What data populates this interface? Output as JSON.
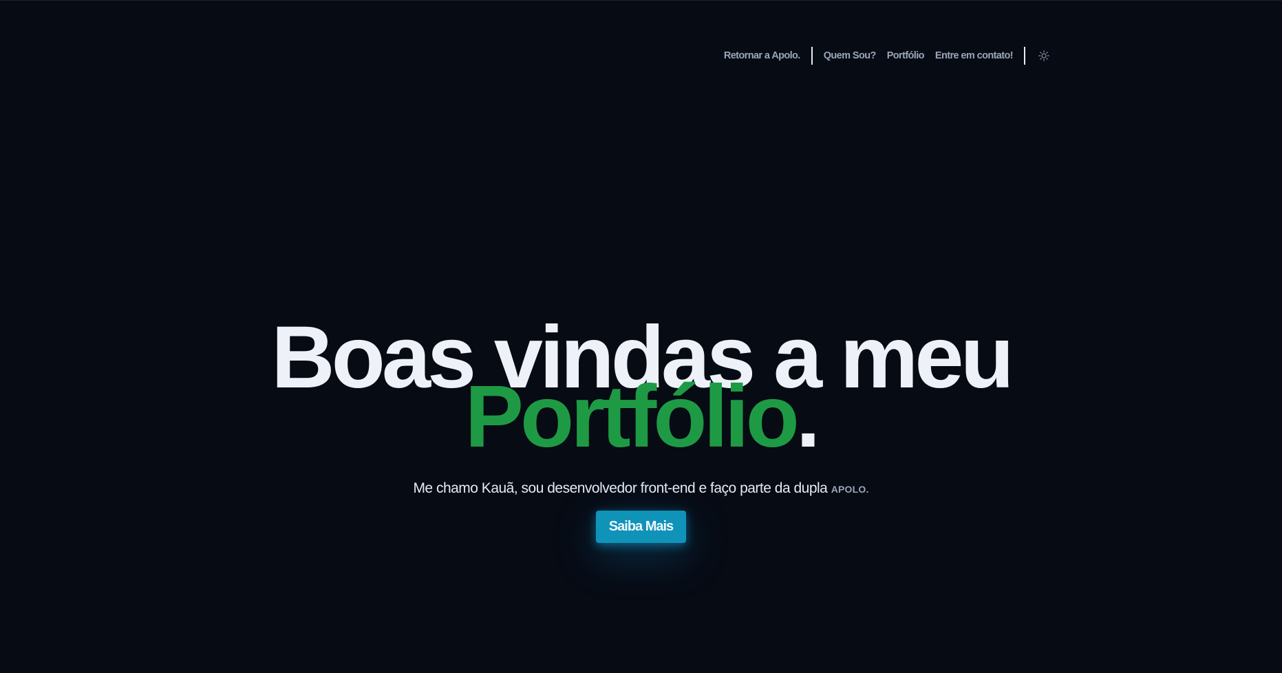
{
  "nav": {
    "back_label": "Retornar a Apolo.",
    "links": [
      "Quem Sou?",
      "Portfólio",
      "Entre em contato!"
    ],
    "theme_toggle_icon": "sun-icon"
  },
  "hero": {
    "headline": "Boas vindas a meu",
    "headline_accent": "Portfólio",
    "headline_dot": ".",
    "subtitle": "Me chamo Kauã, sou desenvolvedor front-end e faço parte da dupla ",
    "subtitle_brand": "APOLO.",
    "cta_label": "Saiba Mais"
  },
  "colors": {
    "background": "#070b14",
    "accent_green": "#1e9a45",
    "cta_blue": "#0f93b9",
    "nav_text": "#9aa6b8"
  }
}
